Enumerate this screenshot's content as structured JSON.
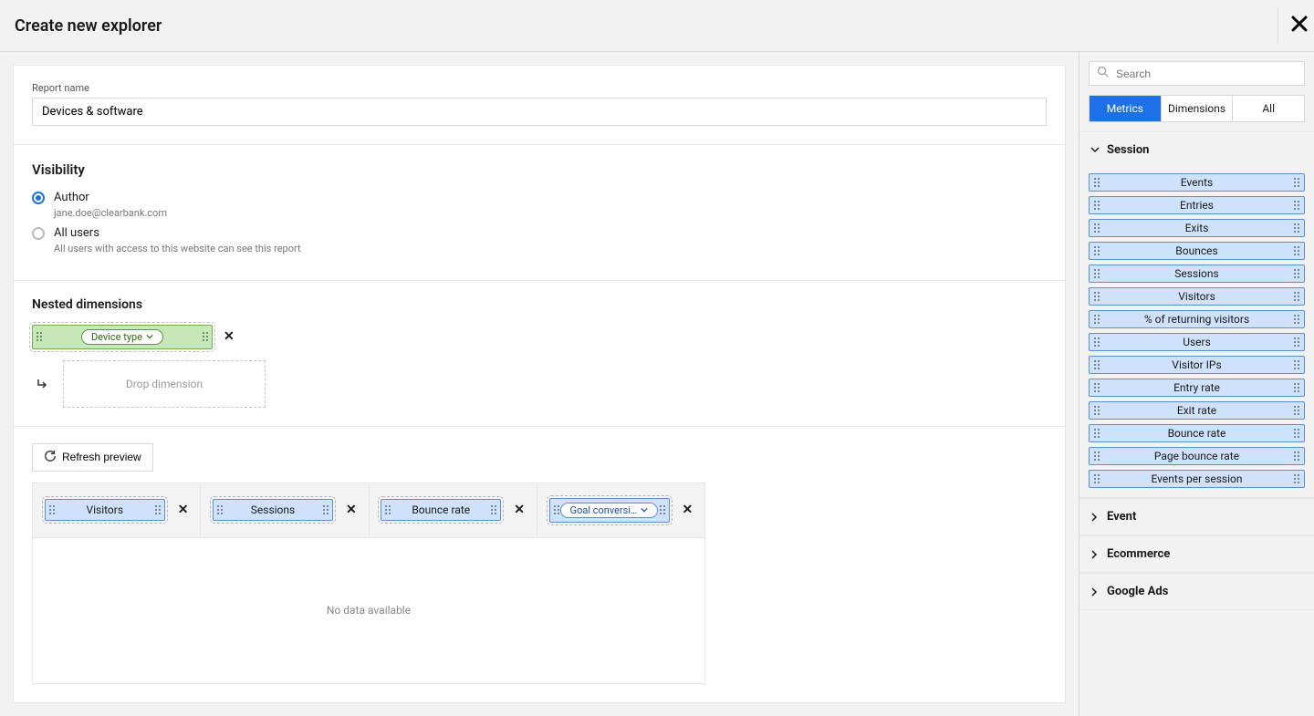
{
  "header": {
    "title": "Create new explorer"
  },
  "report_name": {
    "label": "Report name",
    "value": "Devices & software"
  },
  "visibility": {
    "title": "Visibility",
    "options": [
      {
        "label": "Author",
        "sub": "jane.doe@clearbank.com",
        "checked": true
      },
      {
        "label": "All users",
        "sub": "All users with access to this website can see this report",
        "checked": false
      }
    ]
  },
  "nested": {
    "title": "Nested dimensions",
    "dimension": {
      "label": "Device type"
    },
    "dropzone": "Drop dimension"
  },
  "preview": {
    "refresh_label": "Refresh preview",
    "columns": [
      {
        "label": "Visitors",
        "dropdown": false
      },
      {
        "label": "Sessions",
        "dropdown": false
      },
      {
        "label": "Bounce rate",
        "dropdown": false
      },
      {
        "label": "Goal conversi…",
        "dropdown": true
      }
    ],
    "empty": "No data available"
  },
  "sidebar": {
    "search_placeholder": "Search",
    "tabs": [
      "Metrics",
      "Dimensions",
      "All"
    ],
    "active_tab": 0,
    "categories": [
      {
        "name": "Session",
        "expanded": true,
        "items": [
          "Events",
          "Entries",
          "Exits",
          "Bounces",
          "Sessions",
          "Visitors",
          "% of returning visitors",
          "Users",
          "Visitor IPs",
          "Entry rate",
          "Exit rate",
          "Bounce rate",
          "Page bounce rate",
          "Events per session"
        ]
      },
      {
        "name": "Event",
        "expanded": false,
        "items": []
      },
      {
        "name": "Ecommerce",
        "expanded": false,
        "items": []
      },
      {
        "name": "Google Ads",
        "expanded": false,
        "items": []
      }
    ]
  }
}
